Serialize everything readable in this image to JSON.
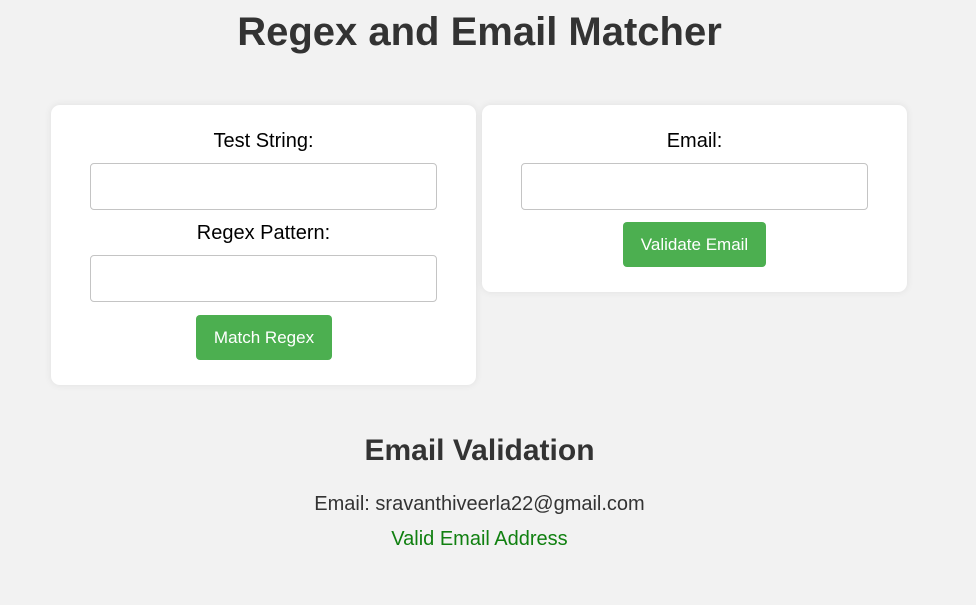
{
  "page": {
    "title": "Regex and Email Matcher"
  },
  "regex_card": {
    "test_string_label": "Test String:",
    "test_string_value": "",
    "pattern_label": "Regex Pattern:",
    "pattern_value": "",
    "match_button_label": "Match Regex"
  },
  "email_card": {
    "email_label": "Email:",
    "email_value": "",
    "validate_button_label": "Validate Email"
  },
  "result": {
    "heading": "Email Validation",
    "email_text": "Email: sravanthiveerla22@gmail.com",
    "status_text": "Valid Email Address"
  },
  "colors": {
    "background": "#f2f2f2",
    "button": "#4caf50",
    "success_text": "#108010",
    "heading_text": "#333333"
  }
}
